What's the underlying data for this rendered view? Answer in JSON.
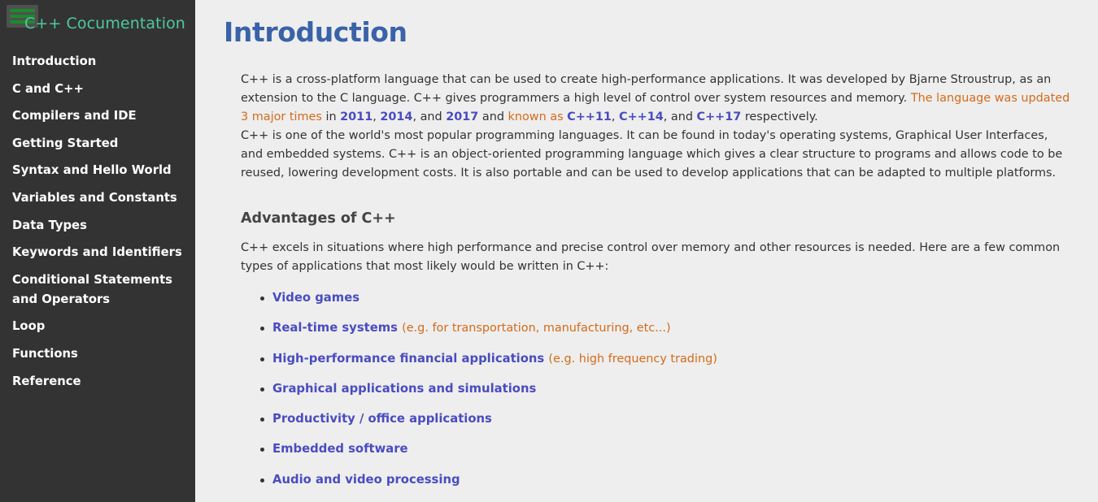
{
  "sidebar": {
    "title": "C++ Cocumentation",
    "items": [
      {
        "label": "Introduction"
      },
      {
        "label": "C and C++"
      },
      {
        "label": "Compilers and IDE"
      },
      {
        "label": "Getting Started"
      },
      {
        "label": "Syntax and Hello World"
      },
      {
        "label": "Variables and Constants"
      },
      {
        "label": "Data Types"
      },
      {
        "label": "Keywords and Identifiers"
      },
      {
        "label": "Conditional Statements and Operators"
      },
      {
        "label": "Loop"
      },
      {
        "label": "Functions"
      },
      {
        "label": "Reference"
      }
    ]
  },
  "main": {
    "title": "Introduction",
    "intro": {
      "p1_text": "C++ is a cross-platform language that can be used to create high-performance applications. It was developed by Bjarne Stroustrup, as an extension to the C language. C++ gives programmers a high level of control over system resources and memory.",
      "p1_highlight": "The language was updated 3 major times",
      "p1_in": "in",
      "year1": "2011",
      "year2": "2014",
      "p1_and": ", and",
      "year3": "2017",
      "p1_and2": "and",
      "p1_known": "known as",
      "ver1": "C++11",
      "ver2": "C++14",
      "p1_and3": ", and",
      "ver3": "C++17",
      "p1_end": "respectively.",
      "p2_text": "C++ is one of the world's most popular programming languages. It can be found in today's operating systems, Graphical User Interfaces, and embedded systems. C++ is an object-oriented programming language which gives a clear structure to programs and allows code to be reused, lowering development costs. It is also portable and can be used to develop applications that can be adapted to multiple platforms."
    },
    "advantages": {
      "heading": "Advantages of C++",
      "text": "C++ excels in situations where high performance and precise control over memory and other resources is needed. Here are a few common types of applications that most likely would be written in C++:",
      "items": [
        {
          "label": "Video games",
          "note": ""
        },
        {
          "label": "Real-time systems",
          "note": "(e.g. for transportation, manufacturing, etc...)"
        },
        {
          "label": "High-performance financial applications",
          "note": "(e.g. high frequency trading)"
        },
        {
          "label": "Graphical applications and simulations",
          "note": ""
        },
        {
          "label": "Productivity / office applications",
          "note": ""
        },
        {
          "label": "Embedded software",
          "note": ""
        },
        {
          "label": "Audio and video processing",
          "note": ""
        }
      ]
    }
  },
  "colors": {
    "sidebar_bg": "#333333",
    "sidebar_title": "#4dc9a0",
    "menu_icon": "#1d8a2c",
    "page_title": "#3a62a8",
    "link": "#4a4cc0",
    "highlight": "#d56a1a",
    "background": "#eeeeee"
  },
  "icons": {
    "menu": "hamburger-menu-icon"
  }
}
